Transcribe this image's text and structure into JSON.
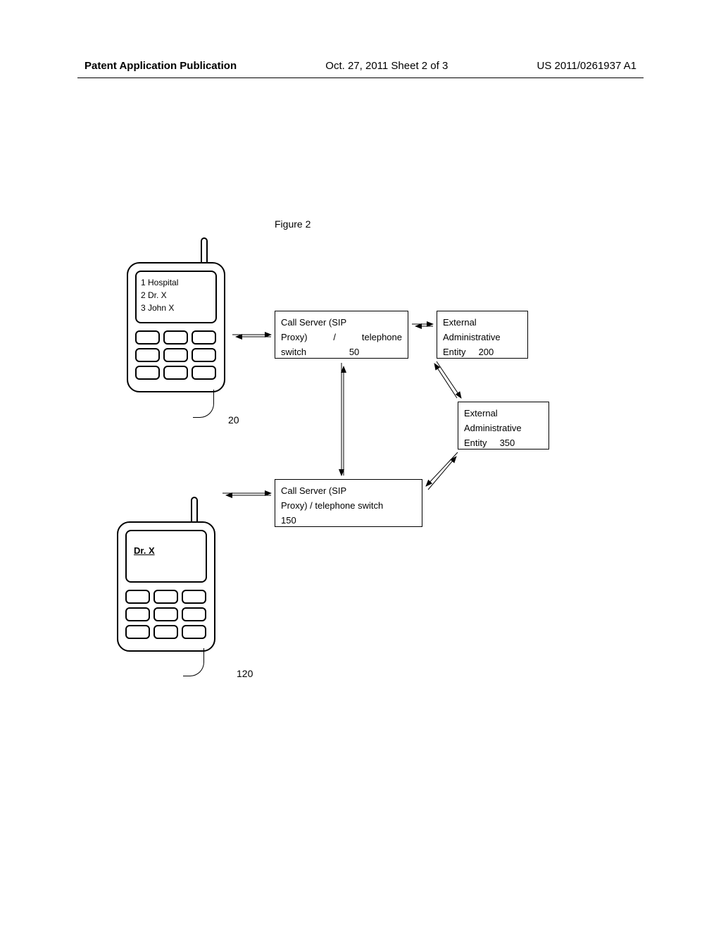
{
  "header": {
    "left": "Patent Application Publication",
    "center": "Oct. 27, 2011  Sheet 2 of 3",
    "right": "US 2011/0261937 A1"
  },
  "figure_title": "Figure 2",
  "phone1": {
    "line1": "1 Hospital",
    "line2": "2 Dr. X",
    "line3": "3 John X",
    "ref": "20"
  },
  "phone2": {
    "line1": "Dr. X",
    "ref": "120"
  },
  "call_server_1": {
    "row1_left": "Call Server (SIP",
    "row2_left": "Proxy)",
    "row2_mid": "/",
    "row2_right": "telephone",
    "row3_left": "switch",
    "ref": "50"
  },
  "ext_admin_1": {
    "line1": "External",
    "line2": "Administrative",
    "line3": "Entity",
    "ref": "200"
  },
  "ext_admin_2": {
    "line1": "External",
    "line2": "Administrative",
    "line3": "Entity",
    "ref": "350"
  },
  "call_server_2": {
    "line1": "Call Server (SIP",
    "line2": "Proxy) / telephone switch",
    "ref": "150"
  }
}
